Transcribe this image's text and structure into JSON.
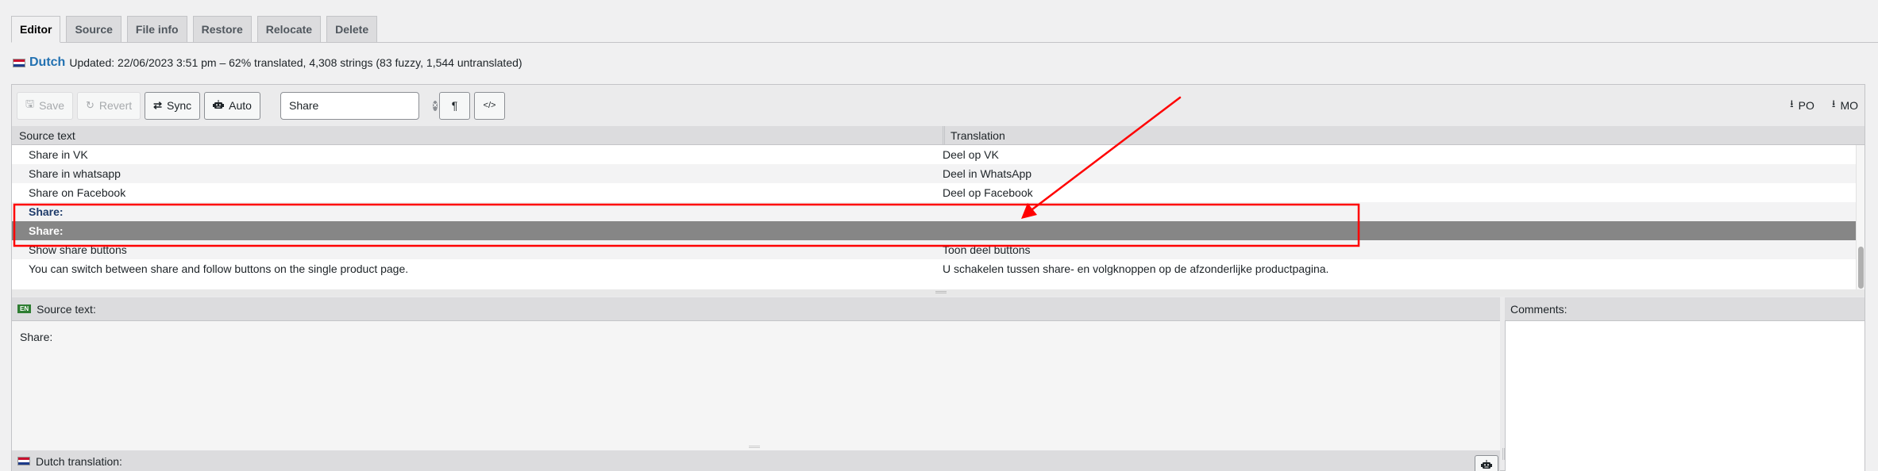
{
  "tabs": [
    {
      "label": "Editor",
      "active": true
    },
    {
      "label": "Source",
      "active": false
    },
    {
      "label": "File info",
      "active": false
    },
    {
      "label": "Restore",
      "active": false
    },
    {
      "label": "Relocate",
      "active": false
    },
    {
      "label": "Delete",
      "active": false
    }
  ],
  "status": {
    "flag_icon": "netherlands-flag-icon",
    "language": "Dutch",
    "summary": "Updated: 22/06/2023 3:51 pm – 62% translated, 4,308 strings (83 fuzzy, 1,544 untranslated)"
  },
  "toolbar": {
    "save_label": "Save",
    "save_icon": "floppy-disk-icon",
    "revert_label": "Revert",
    "revert_icon": "undo-icon",
    "sync_label": "Sync",
    "sync_icon": "sync-icon",
    "auto_label": "Auto",
    "auto_icon": "robot-icon",
    "search_value": "Share",
    "search_clear_icon": "clear-icon",
    "invisibles_label": "¶",
    "code_view_label": "</>",
    "download_po_label": "PO",
    "download_mo_label": "MO",
    "download_icon": "download-icon"
  },
  "grid": {
    "columns": [
      "Source text",
      "Translation"
    ],
    "rows": [
      {
        "source": "Share in VK",
        "translation": "Deel op VK",
        "state": "translated"
      },
      {
        "source": "Share in whatsapp",
        "translation": "Deel in WhatsApp",
        "state": "translated"
      },
      {
        "source": "Share on Facebook",
        "translation": "Deel op Facebook",
        "state": "translated"
      },
      {
        "source": "Share:",
        "translation": "",
        "state": "untranslated"
      },
      {
        "source": "Share:",
        "translation": "",
        "state": "selected"
      },
      {
        "source": "Show share buttons",
        "translation": "Toon deel buttons",
        "state": "translated"
      },
      {
        "source": "You can switch between share and follow buttons on the single product page.",
        "translation": "U schakelen tussen share- en volgknoppen op de afzonderlijke productpagina.",
        "state": "translated"
      }
    ]
  },
  "source_pane": {
    "lang_badge": "EN",
    "label": "Source text:",
    "text": "Share:"
  },
  "comments_pane": {
    "label": "Comments:",
    "text": ""
  },
  "translation_pane": {
    "label": "Dutch translation:",
    "auto_icon": "robot-icon"
  },
  "annotation": {
    "color": "#ff0000"
  }
}
